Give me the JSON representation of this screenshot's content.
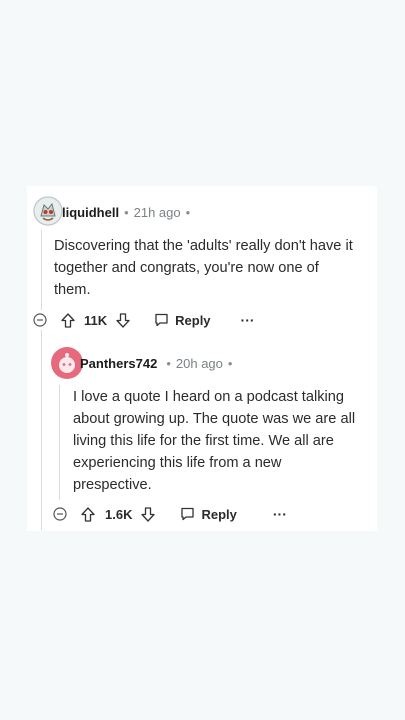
{
  "comments": [
    {
      "username": "liquidhell",
      "time": "21h ago",
      "body": "Discovering that the 'adults' really don't have it together and congrats, you're now one of them.",
      "votes": "11K",
      "reply_label": "Reply",
      "more_label": "···"
    },
    {
      "username": "Panthers742",
      "time": "20h ago",
      "body": "I love a quote I heard on a podcast talking about growing up. The quote was we are all living this life for the first time. We all are experiencing this life from a new prespective.",
      "votes": "1.6K",
      "reply_label": "Reply",
      "more_label": "···"
    }
  ],
  "separator": "•",
  "colors": {
    "background": "#f6f9f9",
    "card": "#ffffff",
    "avatar_reply": "#e66a7e",
    "thread_line": "#d7dcdc"
  }
}
